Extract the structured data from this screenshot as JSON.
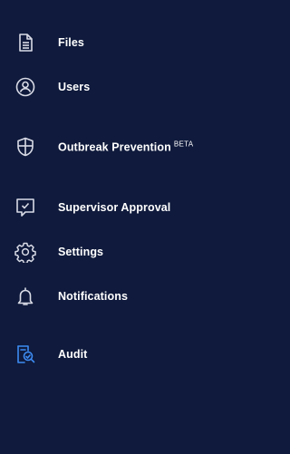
{
  "sidebar": {
    "items": [
      {
        "label": "Files",
        "icon": "document-icon",
        "active": false
      },
      {
        "label": "Users",
        "icon": "user-circle-icon",
        "active": false
      },
      {
        "label": "Outbreak Prevention",
        "badge": "BETA",
        "icon": "shield-icon",
        "active": false
      },
      {
        "label": "Supervisor Approval",
        "icon": "approval-check-icon",
        "active": false
      },
      {
        "label": "Settings",
        "icon": "gear-icon",
        "active": false
      },
      {
        "label": "Notifications",
        "icon": "bell-icon",
        "active": false
      },
      {
        "label": "Audit",
        "icon": "audit-search-icon",
        "active": true
      }
    ],
    "colors": {
      "background": "#0f1a3c",
      "text": "#ffffff",
      "icon": "#d9dbe6",
      "active_icon": "#3d8bf2"
    }
  }
}
